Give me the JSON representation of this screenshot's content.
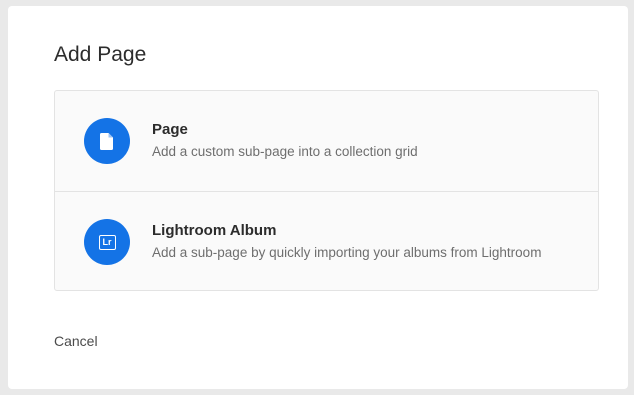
{
  "dialog": {
    "title": "Add Page",
    "options": [
      {
        "title": "Page",
        "description": "Add a custom sub-page into a collection grid",
        "icon": "document-icon"
      },
      {
        "title": "Lightroom Album",
        "description": "Add a sub-page by quickly importing your albums from Lightroom",
        "icon": "lightroom-icon",
        "icon_text": "Lr"
      }
    ],
    "cancel_label": "Cancel"
  },
  "colors": {
    "accent": "#1473e6",
    "background": "#ffffff",
    "option_background": "#fafafa"
  }
}
